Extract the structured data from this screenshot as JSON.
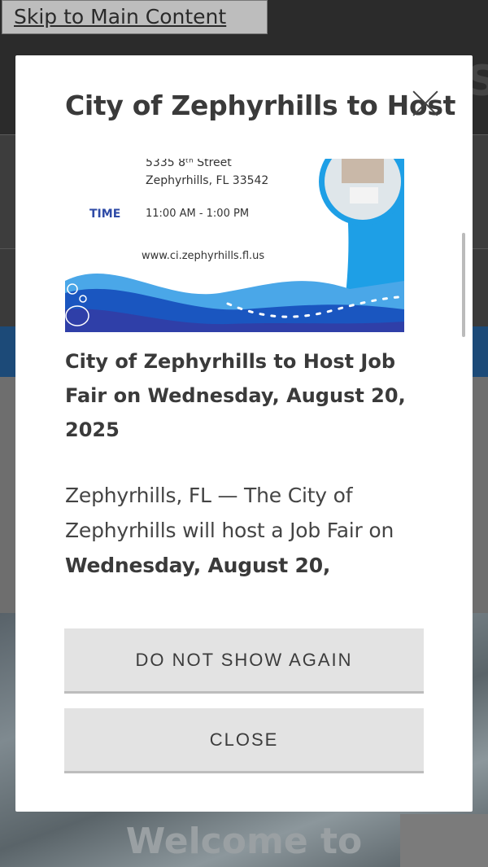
{
  "skip_link": "Skip to Main Content",
  "background": {
    "logo_letter": "S",
    "welcome_text": "Welcome to"
  },
  "modal": {
    "title": "City of Zephyrhills to Host",
    "flyer": {
      "address_line1": "5335 8ᵗʰ Street",
      "address_line2": "Zephyrhills, FL 33542",
      "time_label": "TIME",
      "time_value": "11:00 AM - 1:00 PM",
      "website": "www.ci.zephyrhills.fl.us"
    },
    "article_heading": "City of Zephyrhills to Host Job Fair on Wednesday, August 20, 2025",
    "article_body_intro": "Zephyrhills, FL — The City of Zephyrhills will host a Job Fair on ",
    "article_body_date": "Wednesday, August 20,",
    "buttons": {
      "dont_show": "DO NOT SHOW AGAIN",
      "close": "CLOSE"
    }
  },
  "colors": {
    "flyer_blue": "#1e9fe6",
    "flyer_dark_blue": "#1a56c0",
    "time_label": "#2e4aa6",
    "overlay_dark": "#2b2b2b",
    "button_bg": "#e3e3e3"
  },
  "icons": {
    "close": "close-icon"
  }
}
